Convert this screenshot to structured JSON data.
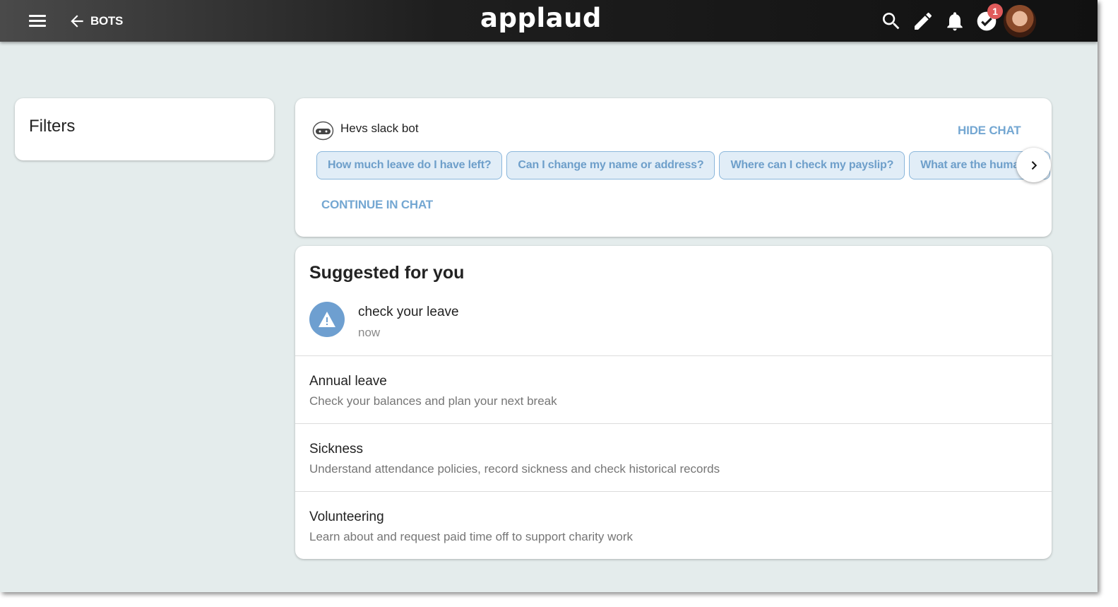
{
  "header": {
    "back_label": "BOTS",
    "logo_text": "applaud",
    "notification_count": "1",
    "icons": [
      "menu-icon",
      "back-arrow-icon",
      "search-icon",
      "pencil-icon",
      "bell-icon",
      "check-circle-icon",
      "avatar"
    ]
  },
  "filters": {
    "title": "Filters"
  },
  "chat": {
    "bot_name": "Hevs slack bot",
    "hide_label": "HIDE CHAT",
    "continue_label": "CONTINUE IN CHAT",
    "suggestions": [
      "How much leave do I have left?",
      "Can I change my name or address?",
      "Where can I check my payslip?",
      "What are the human re"
    ]
  },
  "suggested": {
    "title": "Suggested for you",
    "alert": {
      "title": "check your leave",
      "time": "now"
    },
    "topics": [
      {
        "title": "Annual leave",
        "description": "Check your balances and plan your next break"
      },
      {
        "title": "Sickness",
        "description": "Understand attendance policies, record sickness and check historical records"
      },
      {
        "title": "Volunteering",
        "description": "Learn about and request paid time off to support charity work"
      }
    ]
  },
  "colors": {
    "accent": "#74a7d2",
    "chip_bg": "#e1edf7",
    "badge": "#e05a5a",
    "background": "#e4ecec"
  }
}
